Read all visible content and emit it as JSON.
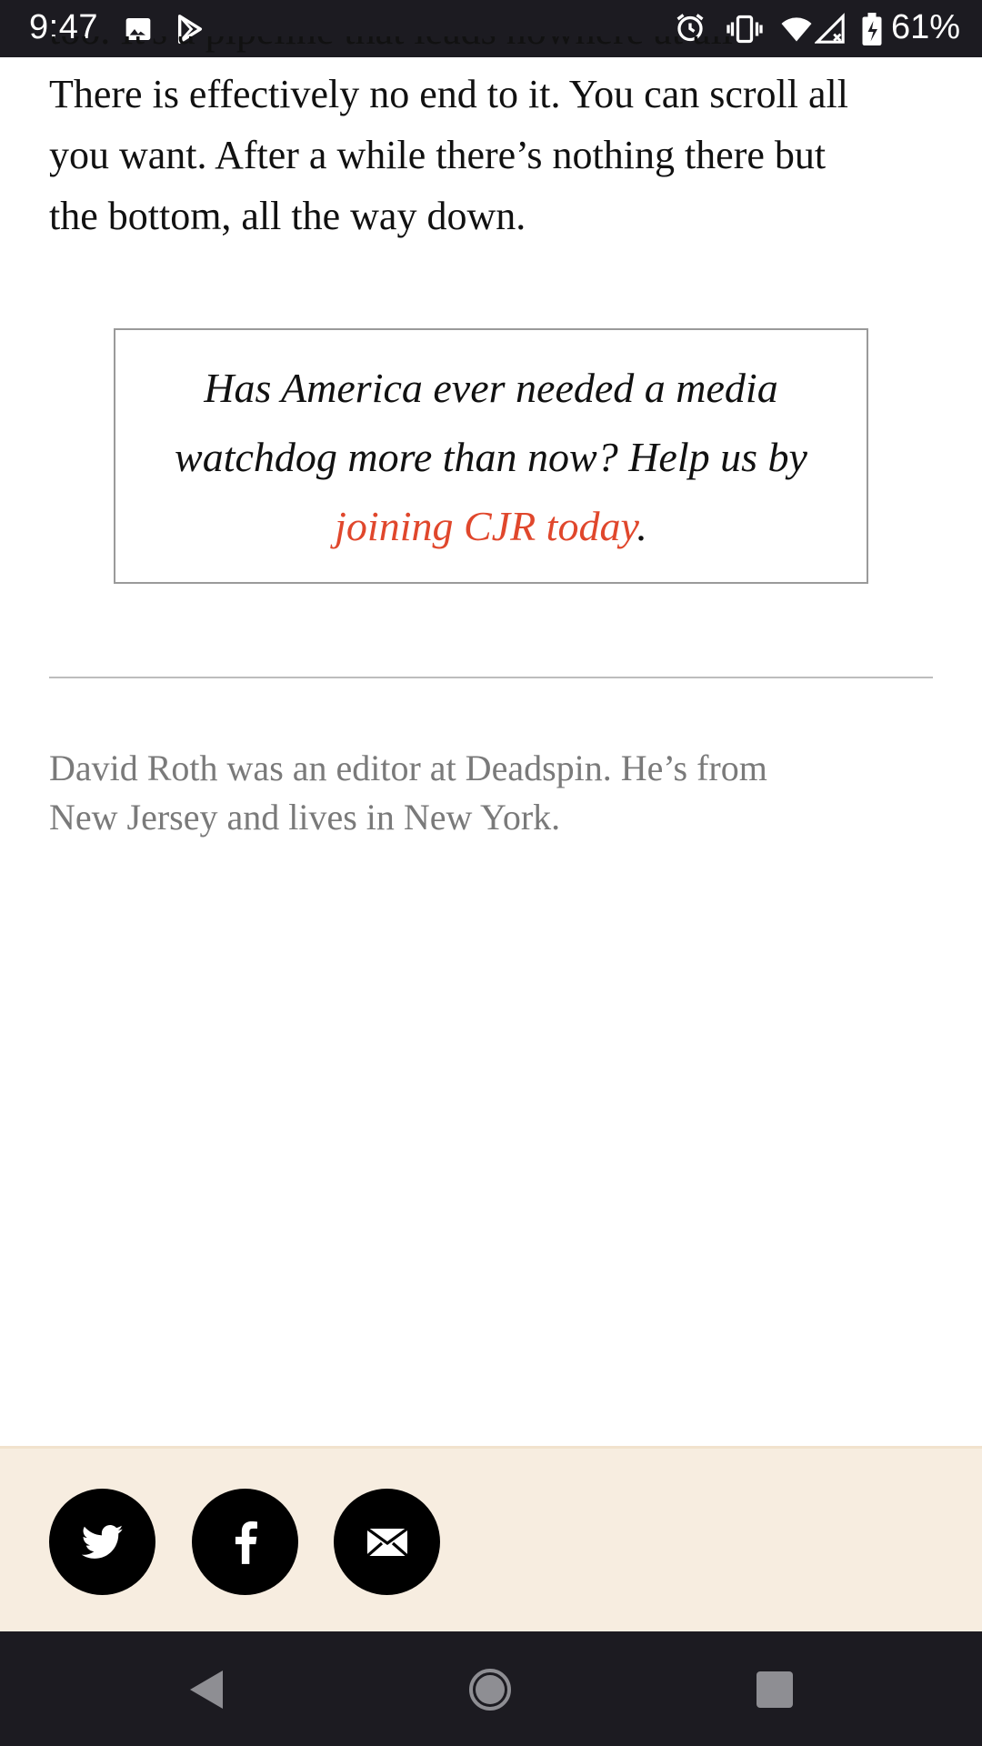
{
  "status_bar": {
    "time": "9:47",
    "battery_percent": "61%",
    "icons": [
      "gallery-icon",
      "play-store-icon",
      "alarm-icon",
      "vibrate-icon",
      "wifi-icon",
      "signal-icon",
      "battery-icon"
    ]
  },
  "article": {
    "partial_line": "too. It's a pipeline that leads nowhere at all",
    "paragraph": [
      "There is effectively no end to it. You can scroll all",
      "you want. After a while there’s nothing there but",
      "the bottom, all the way down."
    ]
  },
  "promo": {
    "line1": "Has America ever needed a media",
    "line2": "watchdog more than now? Help us by",
    "link_text": "joining CJR today",
    "trailing": "."
  },
  "author_bio": {
    "line1": "David Roth was an editor at Deadspin. He’s from",
    "line2": "New Jersey and lives in New York."
  },
  "share": {
    "buttons": [
      "twitter",
      "facebook",
      "email"
    ],
    "background": "#f7ede0"
  },
  "colors": {
    "link": "#e0472c",
    "system_bar": "#1c1b21"
  },
  "nav_bar": {
    "buttons": [
      "back",
      "home",
      "recents"
    ]
  }
}
